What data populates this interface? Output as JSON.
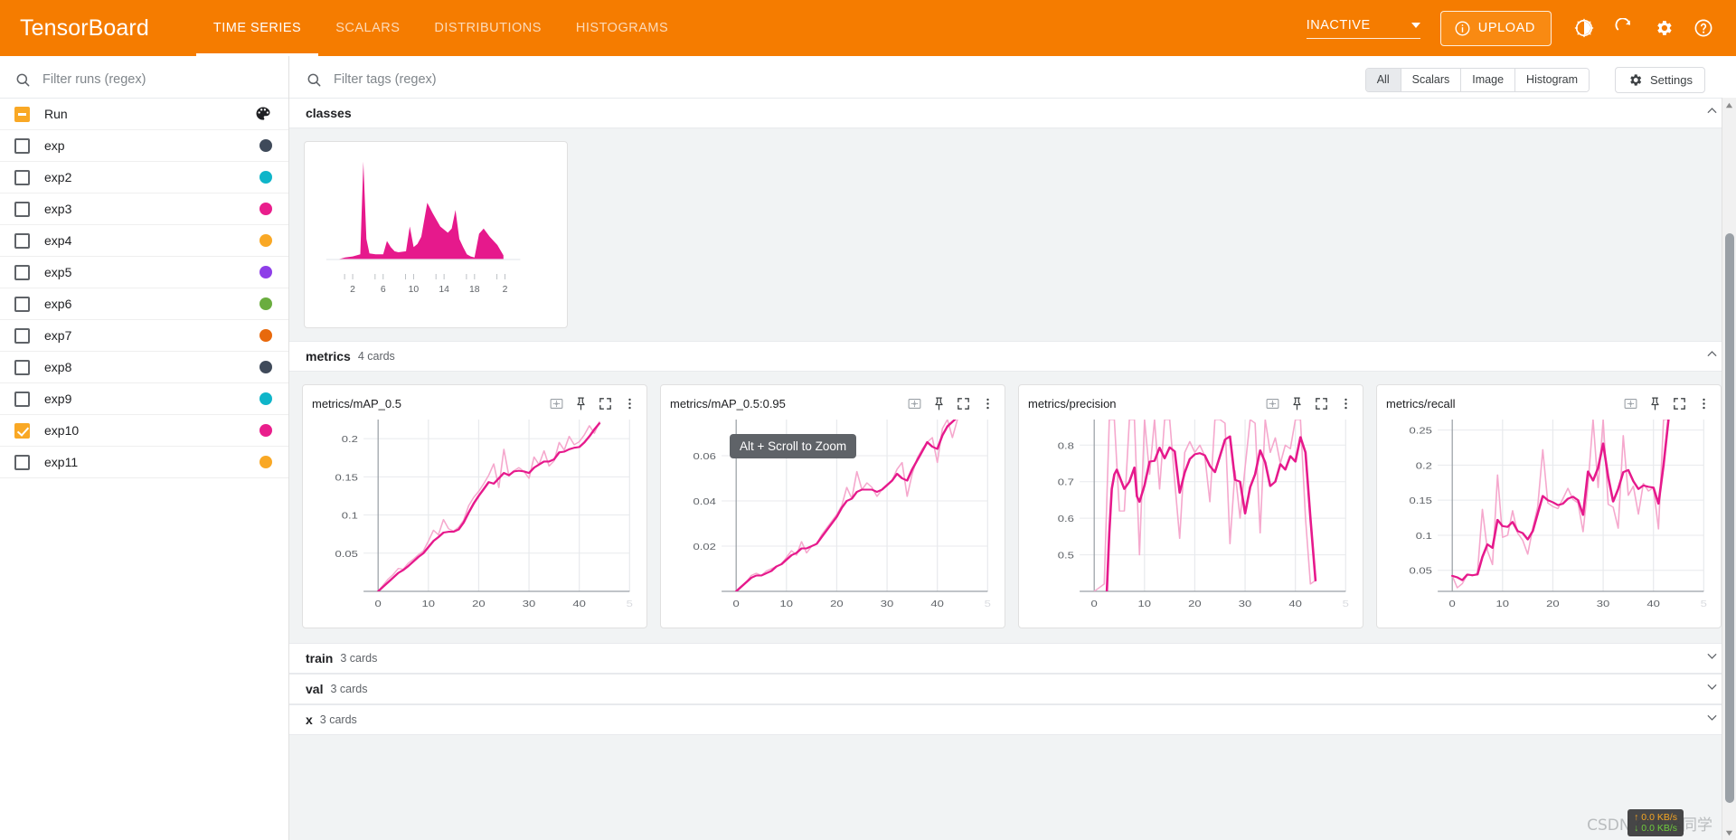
{
  "header": {
    "brand": "TensorBoard",
    "tabs": [
      {
        "label": "TIME SERIES",
        "active": true
      },
      {
        "label": "SCALARS",
        "active": false
      },
      {
        "label": "DISTRIBUTIONS",
        "active": false
      },
      {
        "label": "HISTOGRAMS",
        "active": false
      }
    ],
    "reload_state": "INACTIVE",
    "upload_label": "UPLOAD",
    "icons": [
      "info-icon",
      "brightness-icon",
      "reload-icon",
      "gear-icon",
      "help-icon"
    ],
    "accent_color": "#f57c00"
  },
  "sidebar": {
    "filter_placeholder": "Filter runs (regex)",
    "header_row": {
      "label": "Run",
      "state": "indeterminate",
      "icon": "palette-icon"
    },
    "runs": [
      {
        "label": "exp",
        "checked": false,
        "color": "#3f4a5a"
      },
      {
        "label": "exp2",
        "checked": false,
        "color": "#0fb5c9"
      },
      {
        "label": "exp3",
        "checked": false,
        "color": "#e91e8c"
      },
      {
        "label": "exp4",
        "checked": false,
        "color": "#f9a825"
      },
      {
        "label": "exp5",
        "checked": false,
        "color": "#8e3ee8"
      },
      {
        "label": "exp6",
        "checked": false,
        "color": "#6aad3f"
      },
      {
        "label": "exp7",
        "checked": false,
        "color": "#e8690c"
      },
      {
        "label": "exp8",
        "checked": false,
        "color": "#3f4a5a"
      },
      {
        "label": "exp9",
        "checked": false,
        "color": "#0fb5c9"
      },
      {
        "label": "exp10",
        "checked": true,
        "color": "#e91e8c"
      },
      {
        "label": "exp11",
        "checked": false,
        "color": "#f9a825"
      }
    ]
  },
  "toolbar": {
    "tag_filter_placeholder": "Filter tags (regex)",
    "filters": [
      {
        "label": "All",
        "selected": true
      },
      {
        "label": "Scalars",
        "selected": false
      },
      {
        "label": "Image",
        "selected": false
      },
      {
        "label": "Histogram",
        "selected": false
      }
    ],
    "settings_label": "Settings"
  },
  "sections": [
    {
      "title": "classes",
      "count": "",
      "expanded": true
    },
    {
      "title": "metrics",
      "count": "4 cards",
      "expanded": true
    },
    {
      "title": "train",
      "count": "3 cards",
      "expanded": false
    },
    {
      "title": "val",
      "count": "3 cards",
      "expanded": false
    },
    {
      "title": "x",
      "count": "3 cards",
      "expanded": false
    }
  ],
  "card_tools": [
    "data-table-icon",
    "pin-icon",
    "fullscreen-icon",
    "more-vert-icon"
  ],
  "tooltip": {
    "text": "Alt + Scroll to Zoom"
  },
  "overlay": {
    "net_up": "↑ 0.0 KB/s",
    "net_down": "↓ 0.0 KB/s",
    "watermark": "CSDN @慕溪同学"
  },
  "chart_data": [
    {
      "type": "area",
      "id": "classes-histogram",
      "title": "classes",
      "xlabel": "",
      "ylabel": "",
      "xticks": [
        "2",
        "6",
        "10",
        "14",
        "18",
        "2"
      ],
      "xtick_positions": [
        2,
        6,
        10,
        14,
        18,
        22
      ],
      "xlim": [
        -1,
        24
      ],
      "ylim": [
        0,
        1
      ],
      "grid": false,
      "color": "#e6198c",
      "x": [
        0,
        1,
        2,
        3,
        3.4,
        3.8,
        4.2,
        5,
        6,
        6.5,
        7,
        7.5,
        8,
        9,
        9.5,
        10,
        10.5,
        11,
        11.8,
        12.5,
        13.5,
        14.5,
        15,
        15.5,
        16,
        16.5,
        17,
        17.5,
        18,
        18.6,
        19.2,
        20,
        21,
        21.8
      ],
      "values": [
        0.0,
        0.02,
        0.03,
        0.05,
        0.95,
        0.2,
        0.06,
        0.05,
        0.05,
        0.18,
        0.12,
        0.08,
        0.07,
        0.08,
        0.32,
        0.12,
        0.15,
        0.22,
        0.55,
        0.45,
        0.32,
        0.26,
        0.3,
        0.48,
        0.2,
        0.12,
        0.05,
        0.03,
        0.02,
        0.25,
        0.3,
        0.22,
        0.14,
        0.04
      ]
    },
    {
      "type": "line",
      "id": "metrics-map05",
      "title": "metrics/mAP_0.5",
      "xlabel": "",
      "ylabel": "",
      "xticks": [
        "0",
        "10",
        "20",
        "30",
        "40",
        "5"
      ],
      "yticks": [
        "0.05",
        "0.1",
        "0.15",
        "0.2"
      ],
      "xlim": [
        -2,
        50
      ],
      "ylim": [
        0,
        0.225
      ],
      "grid": true,
      "series": [
        {
          "name": "raw",
          "color": "#f5a8cd",
          "x": [
            0,
            1,
            2,
            3,
            4,
            5,
            6,
            7,
            8,
            9,
            10,
            11,
            12,
            13,
            14,
            15,
            16,
            17,
            18,
            19,
            20,
            21,
            22,
            23,
            24,
            25,
            26,
            27,
            28,
            29,
            30,
            31,
            32,
            33,
            34,
            35,
            36,
            37,
            38,
            39,
            40,
            41,
            42,
            43,
            44
          ],
          "values": [
            0.0,
            0.008,
            0.016,
            0.022,
            0.03,
            0.029,
            0.037,
            0.042,
            0.048,
            0.053,
            0.066,
            0.08,
            0.074,
            0.094,
            0.082,
            0.079,
            0.084,
            0.093,
            0.112,
            0.123,
            0.131,
            0.141,
            0.152,
            0.167,
            0.136,
            0.186,
            0.151,
            0.158,
            0.162,
            0.157,
            0.148,
            0.176,
            0.166,
            0.184,
            0.164,
            0.171,
            0.195,
            0.185,
            0.203,
            0.192,
            0.196,
            0.205,
            0.217,
            0.207,
            0.222
          ]
        },
        {
          "name": "smoothed",
          "color": "#e6198c",
          "x": [
            0,
            1,
            2,
            3,
            4,
            5,
            6,
            7,
            8,
            9,
            10,
            11,
            12,
            13,
            14,
            15,
            16,
            17,
            18,
            19,
            20,
            21,
            22,
            23,
            24,
            25,
            26,
            27,
            28,
            29,
            30,
            31,
            32,
            33,
            34,
            35,
            36,
            37,
            38,
            39,
            40,
            41,
            42,
            43,
            44
          ],
          "values": [
            0.0,
            0.006,
            0.012,
            0.018,
            0.024,
            0.028,
            0.033,
            0.039,
            0.045,
            0.05,
            0.058,
            0.066,
            0.071,
            0.077,
            0.078,
            0.078,
            0.081,
            0.09,
            0.103,
            0.115,
            0.125,
            0.134,
            0.143,
            0.141,
            0.148,
            0.155,
            0.152,
            0.157,
            0.158,
            0.157,
            0.155,
            0.162,
            0.166,
            0.17,
            0.17,
            0.173,
            0.182,
            0.183,
            0.186,
            0.188,
            0.189,
            0.195,
            0.203,
            0.212,
            0.22
          ]
        }
      ]
    },
    {
      "type": "line",
      "id": "metrics-map05095",
      "title": "metrics/mAP_0.5:0.95",
      "xlabel": "",
      "ylabel": "",
      "xticks": [
        "0",
        "10",
        "20",
        "30",
        "40",
        "5"
      ],
      "yticks": [
        "0.02",
        "0.04",
        "0.06"
      ],
      "xlim": [
        -2,
        50
      ],
      "ylim": [
        0,
        0.076
      ],
      "grid": true,
      "series": [
        {
          "name": "raw",
          "color": "#f5a8cd",
          "x": [
            0,
            1,
            2,
            3,
            4,
            5,
            6,
            7,
            8,
            9,
            10,
            11,
            12,
            13,
            14,
            15,
            16,
            17,
            18,
            19,
            20,
            21,
            22,
            23,
            24,
            25,
            26,
            27,
            28,
            29,
            30,
            31,
            32,
            33,
            34,
            35,
            36,
            37,
            38,
            39,
            40,
            41,
            42,
            43,
            44
          ],
          "values": [
            0.0,
            0.002,
            0.004,
            0.007,
            0.008,
            0.007,
            0.009,
            0.01,
            0.011,
            0.012,
            0.015,
            0.018,
            0.016,
            0.022,
            0.017,
            0.02,
            0.021,
            0.025,
            0.028,
            0.031,
            0.034,
            0.038,
            0.046,
            0.041,
            0.053,
            0.045,
            0.048,
            0.046,
            0.042,
            0.045,
            0.047,
            0.049,
            0.054,
            0.057,
            0.042,
            0.052,
            0.059,
            0.063,
            0.066,
            0.068,
            0.057,
            0.072,
            0.076,
            0.068,
            0.076
          ]
        },
        {
          "name": "smoothed",
          "color": "#e6198c",
          "x": [
            0,
            1,
            2,
            3,
            4,
            5,
            6,
            7,
            8,
            9,
            10,
            11,
            12,
            13,
            14,
            15,
            16,
            17,
            18,
            19,
            20,
            21,
            22,
            23,
            24,
            25,
            26,
            27,
            28,
            29,
            30,
            31,
            32,
            33,
            34,
            35,
            36,
            37,
            38,
            39,
            40,
            41,
            42,
            43,
            44
          ],
          "values": [
            0.0,
            0.002,
            0.004,
            0.006,
            0.007,
            0.007,
            0.008,
            0.009,
            0.011,
            0.012,
            0.014,
            0.016,
            0.017,
            0.019,
            0.019,
            0.02,
            0.021,
            0.024,
            0.027,
            0.03,
            0.033,
            0.037,
            0.04,
            0.041,
            0.044,
            0.045,
            0.045,
            0.045,
            0.044,
            0.045,
            0.047,
            0.049,
            0.052,
            0.05,
            0.049,
            0.054,
            0.058,
            0.062,
            0.066,
            0.064,
            0.063,
            0.069,
            0.073,
            0.075,
            0.077
          ]
        }
      ]
    },
    {
      "type": "line",
      "id": "metrics-precision",
      "title": "metrics/precision",
      "xlabel": "",
      "ylabel": "",
      "xticks": [
        "0",
        "10",
        "20",
        "30",
        "40",
        "5"
      ],
      "yticks": [
        "0.5",
        "0.6",
        "0.7",
        "0.8"
      ],
      "xlim": [
        -2,
        50
      ],
      "ylim": [
        0.4,
        0.87
      ],
      "grid": true,
      "series": [
        {
          "name": "raw",
          "color": "#f5a8cd",
          "x": [
            0,
            1,
            2,
            3,
            4,
            5,
            6,
            7,
            8,
            9,
            10,
            11,
            12,
            13,
            14,
            15,
            16,
            17,
            18,
            19,
            20,
            21,
            22,
            23,
            24,
            25,
            26,
            27,
            28,
            29,
            30,
            31,
            32,
            33,
            34,
            35,
            36,
            37,
            38,
            39,
            40,
            41,
            42,
            43,
            44
          ],
          "values": [
            0.4,
            0.41,
            0.42,
            0.87,
            0.87,
            0.62,
            0.62,
            0.87,
            0.87,
            0.5,
            0.87,
            0.72,
            0.87,
            0.68,
            0.87,
            0.87,
            0.7,
            0.545,
            0.78,
            0.81,
            0.78,
            0.8,
            0.77,
            0.645,
            0.87,
            0.87,
            0.86,
            0.53,
            0.73,
            0.6,
            0.74,
            0.87,
            0.86,
            0.56,
            0.87,
            0.78,
            0.82,
            0.75,
            0.8,
            0.79,
            0.87,
            0.87,
            0.6,
            0.42,
            0.43
          ]
        },
        {
          "name": "smoothed",
          "color": "#e6198c",
          "x": [
            2.5,
            3,
            3.5,
            4,
            4.5,
            5,
            6,
            7,
            8,
            8.5,
            9,
            10,
            11,
            12,
            13,
            14,
            15,
            16,
            17,
            18,
            19,
            20,
            21,
            22,
            23,
            24,
            25,
            26,
            27,
            28,
            29,
            30,
            31,
            32,
            33,
            34,
            35,
            36,
            37,
            38,
            39,
            40,
            41,
            42,
            43,
            44
          ],
          "values": [
            0.4,
            0.56,
            0.68,
            0.72,
            0.733,
            0.715,
            0.68,
            0.7,
            0.739,
            0.66,
            0.645,
            0.69,
            0.755,
            0.757,
            0.793,
            0.764,
            0.794,
            0.783,
            0.67,
            0.725,
            0.762,
            0.775,
            0.778,
            0.772,
            0.743,
            0.726,
            0.77,
            0.815,
            0.824,
            0.705,
            0.7,
            0.613,
            0.685,
            0.72,
            0.786,
            0.753,
            0.688,
            0.7,
            0.748,
            0.733,
            0.77,
            0.755,
            0.822,
            0.78,
            0.6,
            0.43
          ]
        }
      ]
    },
    {
      "type": "line",
      "id": "metrics-recall",
      "title": "metrics/recall",
      "xlabel": "",
      "ylabel": "",
      "xticks": [
        "0",
        "10",
        "20",
        "30",
        "40",
        "5"
      ],
      "yticks": [
        "0.05",
        "0.1",
        "0.15",
        "0.2",
        "0.25"
      ],
      "xlim": [
        -2,
        50
      ],
      "ylim": [
        0.02,
        0.265
      ],
      "grid": true,
      "series": [
        {
          "name": "raw",
          "color": "#f5a8cd",
          "x": [
            0,
            1,
            2,
            3,
            4,
            5,
            6,
            7,
            8,
            9,
            10,
            11,
            12,
            13,
            14,
            15,
            16,
            17,
            18,
            19,
            20,
            21,
            22,
            23,
            24,
            25,
            26,
            27,
            28,
            29,
            30,
            31,
            32,
            33,
            34,
            35,
            36,
            37,
            38,
            39,
            40,
            41,
            42,
            43
          ],
          "values": [
            0.042,
            0.025,
            0.031,
            0.044,
            0.042,
            0.046,
            0.137,
            0.078,
            0.058,
            0.186,
            0.097,
            0.1,
            0.135,
            0.103,
            0.093,
            0.073,
            0.11,
            0.141,
            0.222,
            0.146,
            0.141,
            0.138,
            0.152,
            0.167,
            0.151,
            0.146,
            0.105,
            0.172,
            0.265,
            0.168,
            0.265,
            0.144,
            0.14,
            0.11,
            0.242,
            0.157,
            0.17,
            0.13,
            0.174,
            0.163,
            0.168,
            0.109,
            0.265,
            0.265
          ]
        },
        {
          "name": "smoothed",
          "color": "#e6198c",
          "x": [
            0,
            1,
            2,
            3,
            4,
            5,
            6,
            7,
            8,
            9,
            10,
            11,
            12,
            13,
            14,
            15,
            16,
            17,
            18,
            19,
            20,
            21,
            22,
            23,
            24,
            25,
            26,
            27,
            28,
            29,
            30,
            31,
            32,
            33,
            34,
            35,
            36,
            37,
            38,
            39,
            40,
            41,
            42,
            43
          ],
          "values": [
            0.042,
            0.04,
            0.036,
            0.044,
            0.043,
            0.044,
            0.069,
            0.087,
            0.082,
            0.122,
            0.113,
            0.112,
            0.119,
            0.106,
            0.103,
            0.094,
            0.106,
            0.131,
            0.156,
            0.15,
            0.147,
            0.143,
            0.145,
            0.152,
            0.155,
            0.15,
            0.129,
            0.191,
            0.178,
            0.196,
            0.231,
            0.183,
            0.148,
            0.166,
            0.19,
            0.193,
            0.177,
            0.166,
            0.171,
            0.169,
            0.168,
            0.145,
            0.2,
            0.265
          ]
        }
      ]
    }
  ]
}
